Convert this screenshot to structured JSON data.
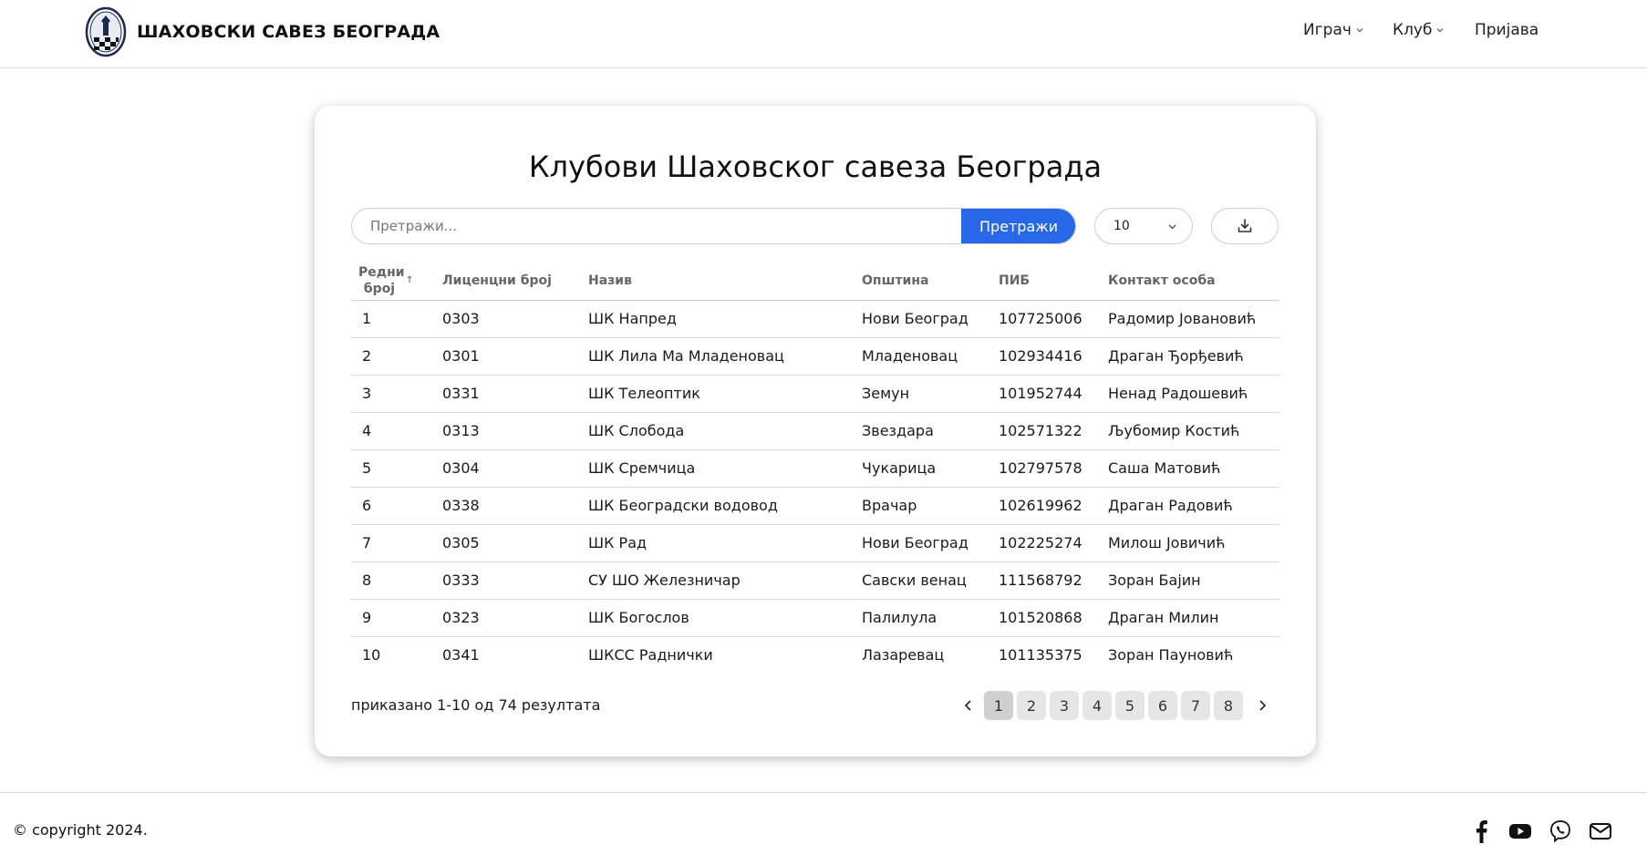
{
  "header": {
    "brand": "ШАХОВСКИ САВЕЗ БЕОГРАДА",
    "nav": [
      {
        "label": "Играч",
        "icon": "chevron-down-icon"
      },
      {
        "label": "Клуб",
        "icon": "chevron-down-icon"
      },
      {
        "label": "Пријава"
      }
    ]
  },
  "main": {
    "title": "Клубови Шаховског савеза Београда",
    "search": {
      "placeholder": "Претражи...",
      "value": "",
      "button_label": "Претражи"
    },
    "page_size": "10",
    "download_icon": "download-icon",
    "accent_color": "#2868e8",
    "table": {
      "columns": [
        "Редни број",
        "Лиценцни број",
        "Назив",
        "Општина",
        "ПИБ",
        "Контакт особа"
      ],
      "sort_icon": "↑",
      "rows": [
        [
          "1",
          "0303",
          "ШК Напред",
          "Нови Београд",
          "107725006",
          "Радомир Јовановић"
        ],
        [
          "2",
          "0301",
          "ШК Лила Ма Младеновац",
          "Младеновац",
          "102934416",
          "Драган Ђорђевић"
        ],
        [
          "3",
          "0331",
          "ШК Телеоптик",
          "Земун",
          "101952744",
          "Ненад Радошевић"
        ],
        [
          "4",
          "0313",
          "ШК Слобода",
          "Звездара",
          "102571322",
          "Љубомир Костић"
        ],
        [
          "5",
          "0304",
          "ШК Сремчица",
          "Чукарица",
          "102797578",
          "Саша Матовић"
        ],
        [
          "6",
          "0338",
          "ШК Београдски водовод",
          "Врачар",
          "102619962",
          "Драган Радовић"
        ],
        [
          "7",
          "0305",
          "ШК Рад",
          "Нови Београд",
          "102225274",
          "Милош Јовичић"
        ],
        [
          "8",
          "0333",
          "СУ ШО Железничар",
          "Савски венац",
          "111568792",
          "Зоран Бајин"
        ],
        [
          "9",
          "0323",
          "ШК Богослов",
          "Палилула",
          "101520868",
          "Драган Милин"
        ],
        [
          "10",
          "0341",
          "ШКСС Раднички",
          "Лазаревац",
          "101135375",
          "Зоран Пауновић"
        ]
      ]
    },
    "result_info": "приказано 1-10 од 74 резултата",
    "pagination": {
      "pages": [
        "1",
        "2",
        "3",
        "4",
        "5",
        "6",
        "7",
        "8"
      ],
      "active": "1"
    }
  },
  "footer": {
    "copyright": "© copyright 2024.",
    "social": [
      "facebook-icon",
      "youtube-icon",
      "viber-icon",
      "mail-icon"
    ]
  }
}
